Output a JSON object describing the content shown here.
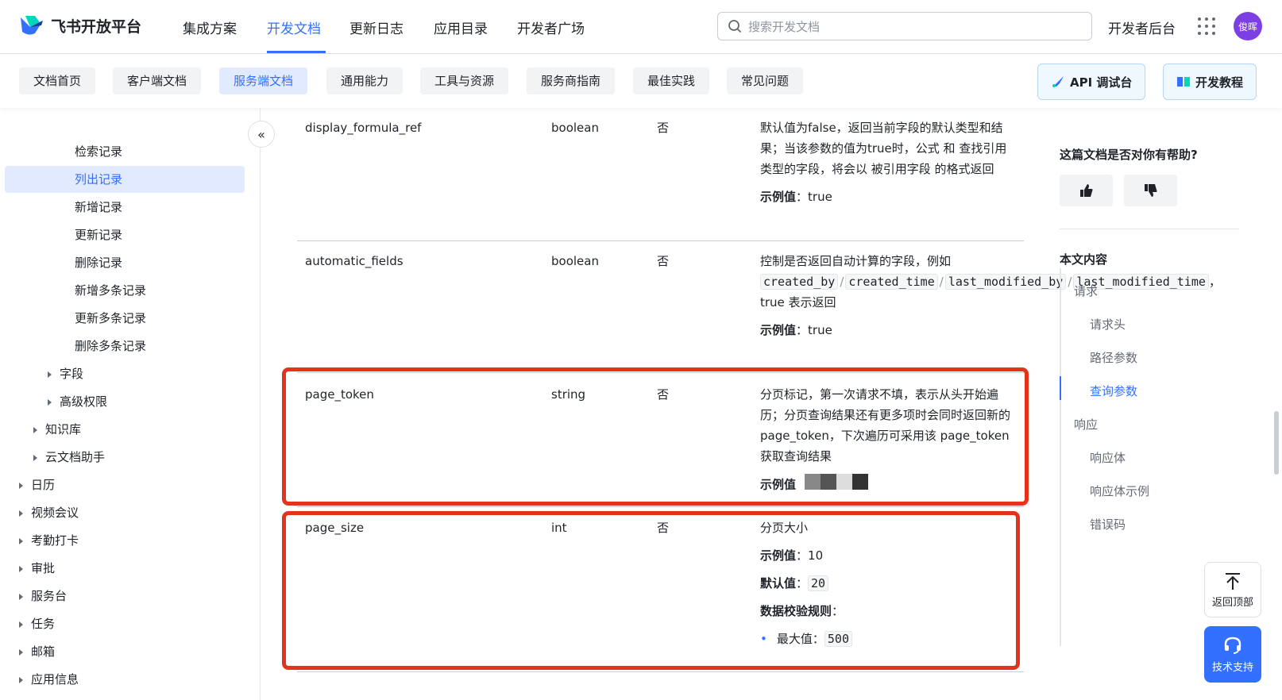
{
  "topnav": {
    "logo": "飞书开放平台",
    "items": [
      "集成方案",
      "开发文档",
      "更新日志",
      "应用目录",
      "开发者广场"
    ],
    "active_index": 1,
    "search_placeholder": "搜索开发文档",
    "dev_console": "开发者后台",
    "avatar": "俊晖"
  },
  "subnav": {
    "pills": [
      "文档首页",
      "客户端文档",
      "服务端文档",
      "通用能力",
      "工具与资源",
      "服务商指南",
      "最佳实践",
      "常见问题"
    ],
    "active_index": 2,
    "api_debug": "API 调试台",
    "tutorial": "开发教程"
  },
  "sidebar": {
    "items": [
      {
        "label": "检索记录",
        "level": 3
      },
      {
        "label": "列出记录",
        "level": 3,
        "active": true
      },
      {
        "label": "新增记录",
        "level": 3
      },
      {
        "label": "更新记录",
        "level": 3
      },
      {
        "label": "删除记录",
        "level": 3
      },
      {
        "label": "新增多条记录",
        "level": 3
      },
      {
        "label": "更新多条记录",
        "level": 3
      },
      {
        "label": "删除多条记录",
        "level": 3
      },
      {
        "label": "字段",
        "level": 2,
        "caret": true
      },
      {
        "label": "高级权限",
        "level": 2,
        "caret": true
      },
      {
        "label": "知识库",
        "level": 1,
        "caret": true
      },
      {
        "label": "云文档助手",
        "level": 1,
        "caret": true
      },
      {
        "label": "日历",
        "level": 0,
        "caret": true
      },
      {
        "label": "视频会议",
        "level": 0,
        "caret": true
      },
      {
        "label": "考勤打卡",
        "level": 0,
        "caret": true
      },
      {
        "label": "审批",
        "level": 0,
        "caret": true
      },
      {
        "label": "服务台",
        "level": 0,
        "caret": true
      },
      {
        "label": "任务",
        "level": 0,
        "caret": true
      },
      {
        "label": "邮箱",
        "level": 0,
        "caret": true
      },
      {
        "label": "应用信息",
        "level": 0,
        "caret": true
      }
    ]
  },
  "params": [
    {
      "name": "display_formula_ref",
      "type": "boolean",
      "required": "否",
      "desc": "默认值为false，返回当前字段的默认类型和结果；当该参数的值为true时，公式 和 查找引用 类型的字段，将会以 被引用字段 的格式返回",
      "example_label": "示例值",
      "example": "true"
    },
    {
      "name": "automatic_fields",
      "type": "boolean",
      "required": "否",
      "desc_prefix": "控制是否返回自动计算的字段，例如",
      "codes": [
        "created_by",
        "created_time",
        "last_modified_by",
        "last_modified_time"
      ],
      "desc_suffix": "true 表示返回",
      "example_label": "示例值",
      "example": "true"
    },
    {
      "name": "page_token",
      "type": "string",
      "required": "否",
      "desc": "分页标记，第一次请求不填，表示从头开始遍历；分页查询结果还有更多项时会同时返回新的 page_token，下次遍历可采用该 page_token 获取查询结果",
      "example_label": "示例值"
    },
    {
      "name": "page_size",
      "type": "int",
      "required": "否",
      "desc": "分页大小",
      "example_label": "示例值",
      "example": "10",
      "default_label": "默认值",
      "default": "20",
      "rules_label": "数据校验规则",
      "max_label": "最大值",
      "max": "500"
    }
  ],
  "right": {
    "help_question": "这篇文档是否对你有帮助?",
    "toc_title": "本文内容",
    "toc": [
      {
        "label": "请求",
        "level": 0
      },
      {
        "label": "请求头",
        "level": 1
      },
      {
        "label": "路径参数",
        "level": 1
      },
      {
        "label": "查询参数",
        "level": 1,
        "active": true
      },
      {
        "label": "响应",
        "level": 0
      },
      {
        "label": "响应体",
        "level": 1
      },
      {
        "label": "响应体示例",
        "level": 1
      },
      {
        "label": "错误码",
        "level": 1
      }
    ],
    "back_to_top": "返回顶部",
    "support": "技术支持"
  },
  "colors": {
    "accent": "#3370ff",
    "highlight_box": "#e3341b"
  }
}
